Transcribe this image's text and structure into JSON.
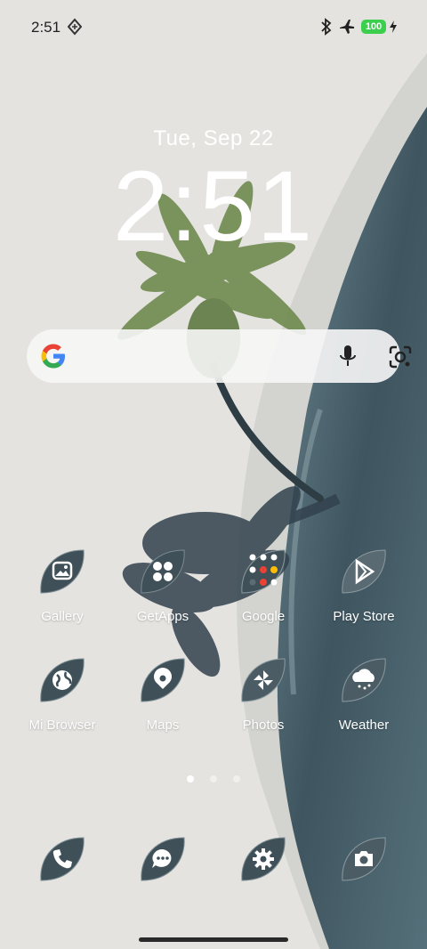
{
  "status_bar": {
    "time": "2:51",
    "battery_level": "100",
    "icons": [
      "notification-diamond-icon",
      "bluetooth-icon",
      "airplane-mode-icon",
      "battery-icon",
      "charging-bolt-icon"
    ]
  },
  "lockscreen": {
    "date": "Tue, Sep 22",
    "time": "2:51"
  },
  "search_bar": {
    "icons": [
      "google-g-icon",
      "microphone-icon",
      "google-lens-icon"
    ]
  },
  "apps": [
    {
      "label": "Gallery",
      "icon": "gallery-icon"
    },
    {
      "label": "GetApps",
      "icon": "getapps-icon"
    },
    {
      "label": "Google",
      "icon": "google-folder-icon"
    },
    {
      "label": "Play Store",
      "icon": "play-store-icon"
    },
    {
      "label": "Mi Browser",
      "icon": "globe-icon"
    },
    {
      "label": "Maps",
      "icon": "map-pin-icon"
    },
    {
      "label": "Photos",
      "icon": "pinwheel-icon"
    },
    {
      "label": "Weather",
      "icon": "cloud-icon"
    }
  ],
  "dock": [
    {
      "icon": "phone-icon"
    },
    {
      "icon": "message-icon"
    },
    {
      "icon": "settings-gear-icon"
    },
    {
      "icon": "camera-icon"
    }
  ],
  "page_indicator": {
    "pages": 3,
    "current": 1
  },
  "colors": {
    "icon_fill": "#3f5058",
    "battery": "#3ccf4e",
    "ocean": "#5e7680",
    "sand": "#e4e3e0"
  }
}
